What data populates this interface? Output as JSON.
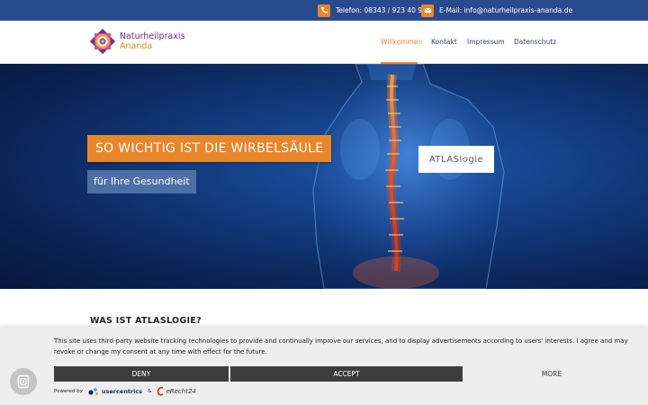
{
  "topbar": {
    "phone": "Telefon: 08343 / 923 40 99",
    "email": "E-Mail: info@naturheilpraxis-ananda.de"
  },
  "header": {
    "logo_line1": "Naturheilpraxis",
    "logo_line2": "Ananda",
    "nav": [
      "Willkommen",
      "Kontakt",
      "Impressum",
      "Datenschutz"
    ],
    "active_nav": "Willkommen"
  },
  "hero": {
    "headline": "SO WICHTIG IST DIE WIRBELSÄULE",
    "subline": "für Ihre Gesundheit",
    "badge_text": "ATLASlogie"
  },
  "content": {
    "section_title": "WAS IST ATLASLOGIE?"
  },
  "cookie": {
    "text": "This site uses third-party website tracking technologies to provide and continually improve our services, and to display advertisements according to users' interests. I agree and may revoke or change my consent at any time with effect for the future.",
    "deny_label": "DENY",
    "accept_label": "ACCEPT",
    "more_label": "MORE",
    "powered_by": "Powered by",
    "brand_usercentrics": "usercentrics",
    "amp": "&",
    "brand_erecht": "eRecht24"
  },
  "colors": {
    "topbar": "#2a4a8e",
    "accent_orange": "#e8862a",
    "nav_text": "#333f6a",
    "hero_dark": "#0b2557",
    "subline_bg": "#4d6fa6",
    "button_dark": "#3d3d3d"
  },
  "icons": {
    "phone": "phone-icon",
    "mail": "mail-icon",
    "privacy_fingerprint": "fingerprint-icon"
  }
}
